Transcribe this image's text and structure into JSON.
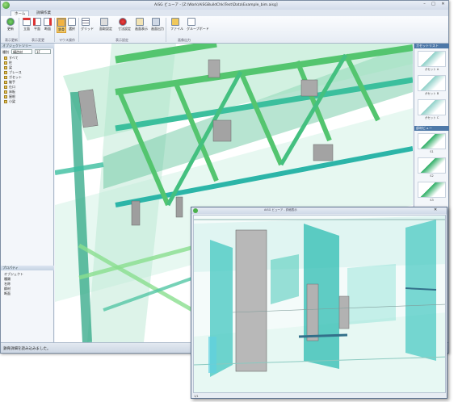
{
  "window": {
    "title": "AiSG ビューア - [Z:\\Work\\AiSGBuildChk\\Test\\Data\\Example_bim.aisg]",
    "status": "鉄骨詳細を読み込みました。"
  },
  "tabs": [
    "ホーム",
    "詳細作業"
  ],
  "ribbon": {
    "buttons": [
      {
        "label": "更新"
      },
      {
        "label": "立面"
      },
      {
        "label": "平面"
      },
      {
        "label": "断面"
      },
      {
        "label": "鉄骨"
      },
      {
        "label": "選択"
      },
      {
        "label": "グリッド"
      },
      {
        "label": "面取設定"
      },
      {
        "label": "寸法設定"
      },
      {
        "label": "画面表示"
      },
      {
        "label": "画面出力"
      },
      {
        "label": "ファイル"
      },
      {
        "label": "グループボード"
      }
    ],
    "groups": [
      "表示更新",
      "表示変更",
      "マウス操作",
      "表示設定",
      "画像出力"
    ]
  },
  "left_panel": {
    "header": "オブジェクトツリー",
    "filter_label": "種別",
    "filter_value": "構造材",
    "floor_value": "1F",
    "tree": [
      "すべて",
      "柱",
      "梁",
      "ブレース",
      "ガセット",
      "継手",
      "仕口",
      "床板",
      "屋根",
      "小梁"
    ],
    "props_header": "プロパティ",
    "props": [
      "オブジェクト",
      "種類",
      "名称",
      "鋼材",
      "断面"
    ]
  },
  "right_panel": {
    "header1": "ガセットリスト",
    "thumbs1": [
      "ガセット A",
      "ガセット B",
      "ガセット C"
    ],
    "header2": "部材ビュー",
    "thumbs2": [
      "S1",
      "S2",
      "S3"
    ]
  },
  "front_window": {
    "title": "AiSG ビューア - 詳細表示",
    "status": "1/1"
  },
  "colors": {
    "steel_green": "#63cc86",
    "steel_cyan": "#33c2b8",
    "plate_gray": "#9a9a9a",
    "accent": "#4d78a8"
  }
}
